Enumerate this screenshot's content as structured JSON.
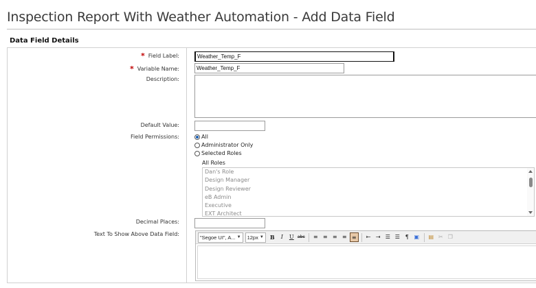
{
  "page": {
    "title": "Inspection Report With Weather Automation - Add Data Field",
    "section_title": "Data Field Details"
  },
  "form": {
    "field_label": {
      "label": "Field Label:",
      "required": "*",
      "value": "Weather_Temp_F"
    },
    "variable_name": {
      "label": "Variable Name:",
      "required": "*",
      "value": "Weather_Temp_F"
    },
    "description": {
      "label": "Description:",
      "value": ""
    },
    "default_value": {
      "label": "Default Value:",
      "value": ""
    },
    "field_permissions": {
      "label": "Field Permissions:",
      "options": [
        "All",
        "Administrator Only",
        "Selected Roles"
      ],
      "selected": "All"
    },
    "roles": {
      "caption": "All Roles",
      "items": [
        "Dan's Role",
        "Design Manager",
        "Design Reviewer",
        "eB Admin",
        "Executive",
        "EXT Architect"
      ]
    },
    "decimal_places": {
      "label": "Decimal Places:",
      "value": ""
    },
    "text_above": {
      "label": "Text To Show Above Data Field:"
    }
  },
  "editor": {
    "font_family": "\"Segoe UI\", A...",
    "font_size": "12px",
    "bold": "B",
    "italic": "I",
    "underline": "U",
    "strike": "abc"
  },
  "colors": {
    "required": "#c00000",
    "radio_selected": "#1a5fb4",
    "border": "#d0d0d0"
  }
}
